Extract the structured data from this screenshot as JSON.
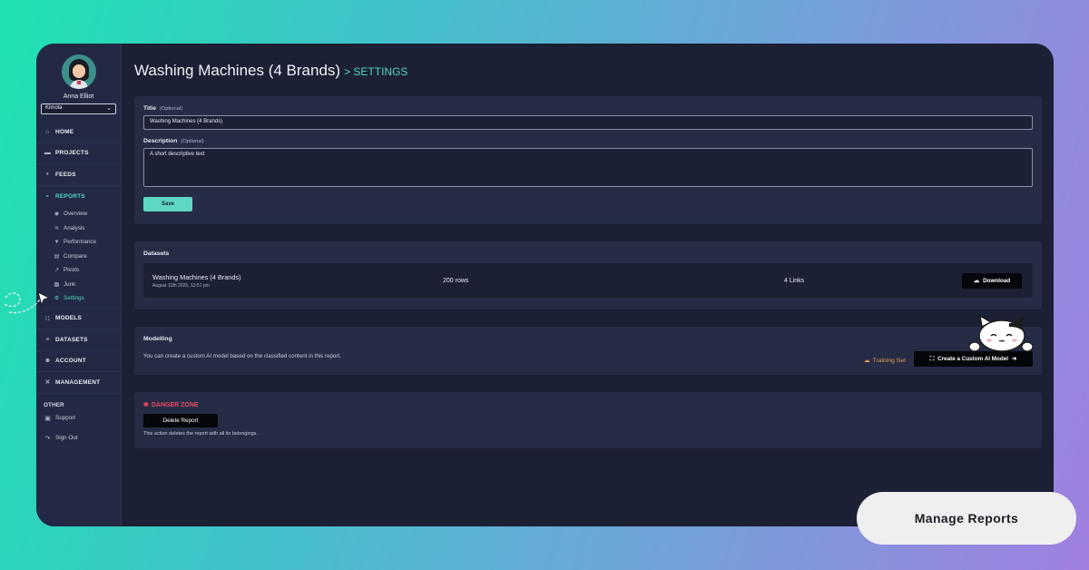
{
  "user": {
    "name": "Anna Elliot",
    "org": "Kimola"
  },
  "nav": {
    "home": "HOME",
    "projects": "PROJECTS",
    "feeds": "FEEDS",
    "reports": "REPORTS",
    "reports_sub": [
      "Overview",
      "Analysis",
      "Performance",
      "Compare",
      "Pivots",
      "Junk",
      "Settings"
    ],
    "models": "MODELS",
    "datasets": "DATASETS",
    "account": "ACCOUNT",
    "management": "MANAGEMENT",
    "other_heading": "OTHER",
    "support": "Support",
    "sign_out": "Sign Out"
  },
  "header": {
    "title": "Washing Machines (4 Brands)",
    "crumb": "> SETTINGS"
  },
  "form": {
    "title_label": "Title",
    "title_optional": "(Optional)",
    "title_value": "Washing Machines (4 Brands)",
    "desc_label": "Description",
    "desc_optional": "(Optional)",
    "desc_value": "A short descriptive text",
    "save": "Save"
  },
  "datasets": {
    "heading": "Datasets",
    "row": {
      "name": "Washing Machines (4 Brands)",
      "date": "August 12th 2025, 13:51 pm",
      "rows": "200 rows",
      "links": "4 Links",
      "download": "Download"
    }
  },
  "modelling": {
    "heading": "Modelling",
    "text": "You can create a custom AI model based on the classified content in this report.",
    "training_set": "Training Set",
    "create_button": "Create a Custom AI Model"
  },
  "danger": {
    "heading": "DANGER ZONE",
    "delete_button": "Delete Report",
    "text": "This action deletes the report with all its belongings."
  },
  "promo": {
    "label": "Manage Reports"
  },
  "colors": {
    "accent": "#4fd6c0",
    "danger": "#e8485f",
    "training": "#e0a04a",
    "panel": "#262c46",
    "window": "#1c2034"
  },
  "icons": {
    "home": "home-icon",
    "projects": "folder-icon",
    "feeds": "feed-icon",
    "reports": "bar-chart-icon",
    "models": "grid-icon",
    "datasets": "stack-icon",
    "account": "users-icon",
    "management": "tools-icon",
    "support": "support-icon",
    "sign_out": "sign-out-icon",
    "download": "cloud-download-icon",
    "training": "cloud-icon",
    "create_model": "expand-icon",
    "danger": "bug-icon"
  }
}
